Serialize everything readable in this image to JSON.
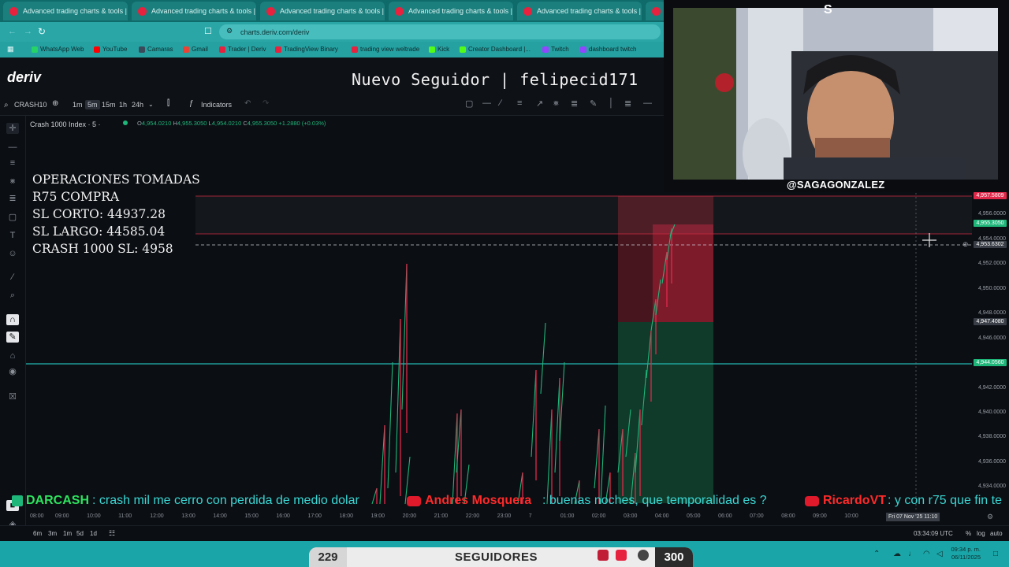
{
  "browser": {
    "tabs": [
      {
        "title": "Advanced trading charts & tools | Tr"
      },
      {
        "title": "Advanced trading charts & tools | Tr"
      },
      {
        "title": "Advanced trading charts & tools | Tr"
      },
      {
        "title": "Advanced trading charts & tools | Tr"
      },
      {
        "title": "Advanced trading charts & tools | Tr"
      }
    ],
    "url": "charts.deriv.com/deriv",
    "bookmarks": [
      {
        "label": "WhatsApp Web",
        "color": "#25d366"
      },
      {
        "label": "YouTube",
        "color": "#ff0000"
      },
      {
        "label": "Camaras",
        "color": "#3a4a5a"
      },
      {
        "label": "Gmail",
        "color": "#ea4335"
      },
      {
        "label": "Trader | Deriv",
        "color": "#e6223e"
      },
      {
        "label": "TradingView Binary",
        "color": "#e6223e"
      },
      {
        "label": "trading view weltrade",
        "color": "#e6223e"
      },
      {
        "label": "Kick",
        "color": "#53fc18"
      },
      {
        "label": "Creator Dashboard |...",
        "color": "#53fc18"
      },
      {
        "label": "Twitch",
        "color": "#9146ff"
      },
      {
        "label": "dashboard twitch",
        "color": "#9146ff"
      }
    ]
  },
  "app": {
    "logo": "deriv",
    "follower_banner": "Nuevo Seguidor | felipecid171"
  },
  "toolbar": {
    "symbol": "CRASH10",
    "timeframes": [
      "1m",
      "5m",
      "15m",
      "1h",
      "24h"
    ],
    "selected_timeframe": "5m",
    "indicators_label": "Indicators"
  },
  "chart": {
    "legend": "Crash 1000 Index · 5 ·",
    "ohlc": {
      "o": "4,954.0210",
      "h": "4,955.3050",
      "l": "4,954.0210",
      "c": "4,955.3050",
      "change": "+1.2880 (+0.03%)"
    },
    "overlay_lines": [
      "OPERACIONES TOMADAS",
      "R75 COMPRA",
      "SL CORTO: 44937.28",
      "SL LARGO: 44585.04",
      "CRASH 1000 SL: 4958"
    ]
  },
  "chart_data": {
    "type": "line",
    "title": "Crash 1000 Index · 5",
    "y_ticks": [
      "4,956.0000",
      "4,954.0000",
      "4,952.0000",
      "4,950.0000",
      "4,948.0000",
      "4,946.0000",
      "4,944.0000",
      "4,942.0000",
      "4,940.0000",
      "4,938.0000",
      "4,936.0000",
      "4,934.0000"
    ],
    "x_ticks": [
      "08:00",
      "09:00",
      "10:00",
      "11:00",
      "12:00",
      "13:00",
      "14:00",
      "15:00",
      "16:00",
      "17:00",
      "18:00",
      "19:00",
      "20:00",
      "21:00",
      "22:00",
      "23:00",
      "7",
      "01:00",
      "02:00",
      "03:00",
      "04:00",
      "05:00",
      "06:00",
      "07:00",
      "08:00",
      "09:00",
      "10:00"
    ],
    "price_tags": [
      {
        "label": "4,957.5809",
        "color": "#e0294a"
      },
      {
        "label": "4,955.3050",
        "color": "#1fb67a"
      },
      {
        "label": "4,953.6302",
        "color": "#3a3f47"
      },
      {
        "label": "4,947.4080",
        "color": "#3a3f47"
      },
      {
        "label": "4,944.0560",
        "color": "#1fb67a"
      }
    ],
    "crosshair_time": "Fri 07 Nov '25   11:10",
    "ylim": [
      4933,
      4958
    ],
    "grid": false
  },
  "periods": [
    "6m",
    "3m",
    "1m",
    "5d",
    "1d"
  ],
  "time_status": "03:34:09 UTC",
  "axis_modes": [
    "%",
    "log",
    "auto"
  ],
  "webcam": {
    "handle": "@SAGAGONZALEZ"
  },
  "chat": [
    {
      "user": "DARCASH",
      "message": ": crash mil me cerro con perdida de medio dolar"
    },
    {
      "user": "Andres Mosquera",
      "message": ": buenas noches, que temporalidad es ?"
    },
    {
      "user": "RicardoVT",
      "message": ": y con r75 que fin te"
    }
  ],
  "followers": {
    "current": "229",
    "label": "SEGUIDORES",
    "goal": "300"
  },
  "clock": {
    "time": "09:34 p. m.",
    "date": "06/11/2025"
  },
  "colors": {
    "bull": "#1fb67a",
    "bear": "#e0294a",
    "accent": "#1aa6a8"
  }
}
